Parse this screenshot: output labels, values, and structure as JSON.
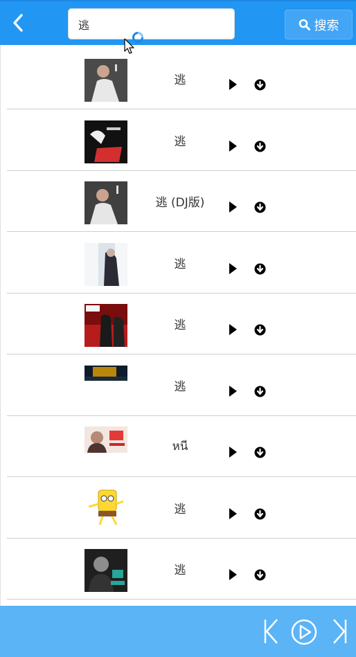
{
  "header": {
    "back_icon": "chevron-left-icon",
    "search": {
      "value": "逃",
      "placeholder": ""
    },
    "search_button_label": "搜索",
    "accent_color": "#2196f3"
  },
  "songs": [
    {
      "title": "逃"
    },
    {
      "title": "逃"
    },
    {
      "title": "逃 (DJ版)"
    },
    {
      "title": "逃"
    },
    {
      "title": "逃"
    },
    {
      "title": "逃"
    },
    {
      "title": "หนี"
    },
    {
      "title": "逃"
    },
    {
      "title": "逃"
    }
  ],
  "player": {
    "prev_icon": "skip-back-icon",
    "play_icon": "play-circle-icon",
    "next_icon": "skip-forward-icon",
    "bar_color": "#5ab4f6"
  }
}
